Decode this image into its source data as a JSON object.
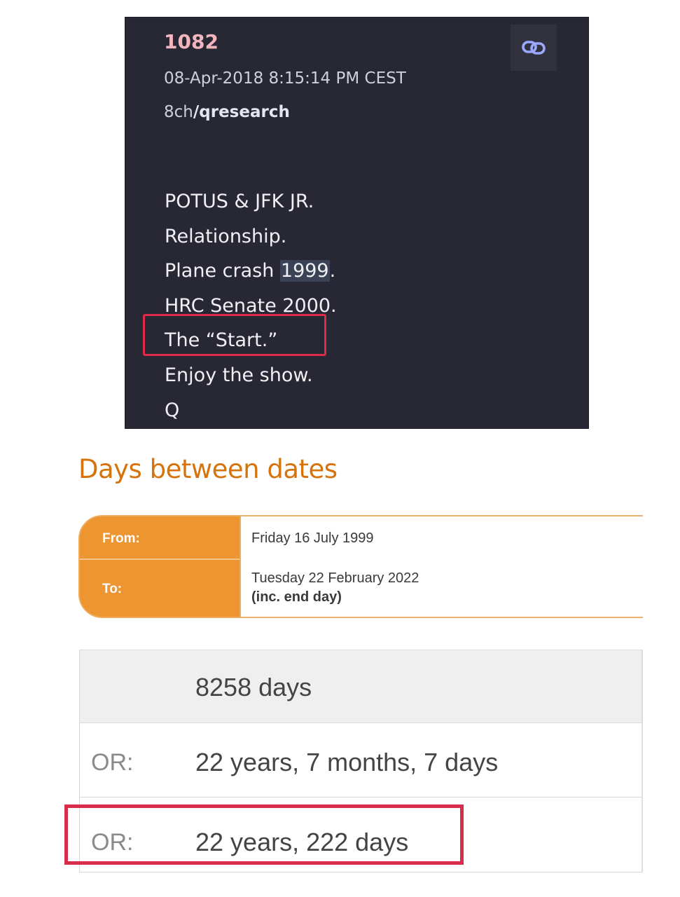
{
  "post": {
    "number": "1082",
    "timestamp": "08-Apr-2018 8:15:14 PM CEST",
    "board_prefix": "8ch",
    "board_name": "/qresearch",
    "link_icon": "link-icon",
    "lines": [
      {
        "before": "POTUS & JFK JR.",
        "highlight": "",
        "after": ""
      },
      {
        "before": "Relationship.",
        "highlight": "",
        "after": ""
      },
      {
        "before": "Plane crash ",
        "highlight": "1999",
        "after": "."
      },
      {
        "before": "HRC Senate 2000.",
        "highlight": "",
        "after": ""
      },
      {
        "before": "The “Start.”",
        "highlight": "",
        "after": ""
      },
      {
        "before": "Enjoy the show.",
        "highlight": "",
        "after": ""
      },
      {
        "before": "Q",
        "highlight": "",
        "after": ""
      }
    ]
  },
  "calculator": {
    "title": "Days between dates",
    "from_label": "From:",
    "to_label": "To:",
    "from_value": "Friday 16 July 1999",
    "to_value": "Tuesday 22 February 2022",
    "to_note": "(inc. end day)",
    "total_days": "8258 days",
    "or_label_1": "OR:",
    "alt_1": "22 years, 7 months, 7 days",
    "or_label_2": "OR:",
    "alt_2": "22 years, 222 days"
  },
  "colors": {
    "post_background": "#272833",
    "post_number": "#f2b4bd",
    "title_orange": "#d5740d",
    "label_orange": "#ed9531",
    "annotation_red": "#e02a49"
  }
}
